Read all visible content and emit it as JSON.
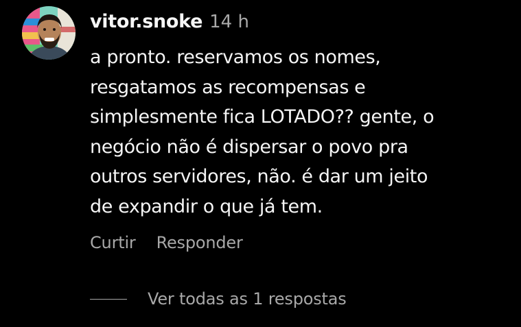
{
  "comment": {
    "username": "vitor.snoke",
    "timestamp": "14 h",
    "avatar_icon": "profile-photo-avatar",
    "lines": [
      "a pronto. reservamos os nomes,",
      "resgatamos as recompensas e",
      "simplesmente fica LOTADO?? gente, o",
      "negócio não é dispersar o povo pra",
      "outros servidores, não. é dar um jeito",
      "de expandir o que já tem."
    ],
    "actions": {
      "like_label": "Curtir",
      "reply_label": "Responder"
    },
    "view_replies_label": "Ver todas as 1 respostas"
  },
  "colors": {
    "background": "#000000",
    "primary_text": "#f5f5f5",
    "secondary_text": "#a8a8a8"
  }
}
